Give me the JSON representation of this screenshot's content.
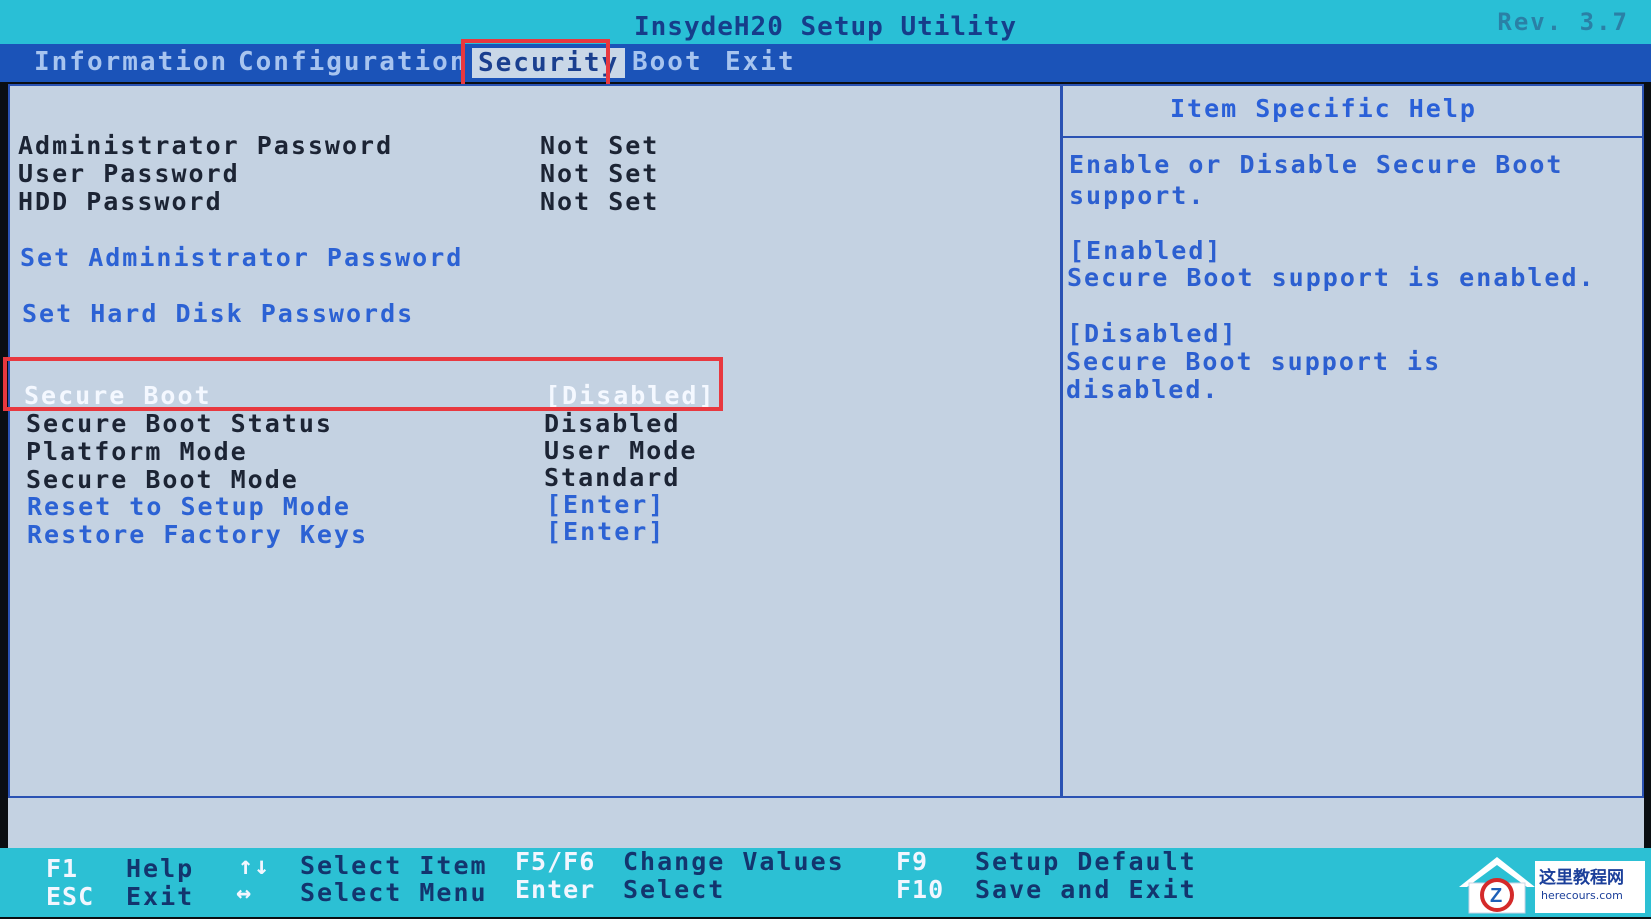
{
  "title": "InsydeH20 Setup Utility",
  "revision": "Rev. 3.7",
  "menu": [
    "Information",
    "Configuration",
    "Security",
    "Boot",
    "Exit"
  ],
  "active_menu": "Security",
  "security": {
    "passwords": [
      {
        "label": "Administrator Password",
        "value": "Not Set"
      },
      {
        "label": "User Password",
        "value": "Not Set"
      },
      {
        "label": "HDD Password",
        "value": "Not Set"
      }
    ],
    "set_admin_label": "Set Administrator Password",
    "set_hdd_label": "Set Hard Disk Passwords",
    "secure_boot": {
      "label": "Secure Boot",
      "value": "[Disabled]"
    },
    "secure_boot_status": {
      "label": "Secure Boot Status",
      "value": "Disabled"
    },
    "platform_mode": {
      "label": "Platform Mode",
      "value": "User Mode"
    },
    "secure_boot_mode": {
      "label": "Secure Boot Mode",
      "value": "Standard"
    },
    "reset_setup_mode": {
      "label": "Reset to Setup Mode",
      "value": "[Enter]"
    },
    "restore_factory_keys": {
      "label": "Restore Factory Keys",
      "value": "[Enter]"
    }
  },
  "help": {
    "title": "Item Specific Help",
    "lines": [
      "Enable or Disable Secure Boot",
      "support.",
      "[Enabled]",
      "Secure Boot support is enabled.",
      "[Disabled]",
      "Secure Boot support is",
      "disabled."
    ]
  },
  "footer": {
    "f1_key": "F1",
    "f1_desc": "Help",
    "esc_key": "ESC",
    "esc_desc": "Exit",
    "updown_key": "↑↓",
    "updown_desc": "Select Item",
    "leftright_key": "↔",
    "leftright_desc": "Select Menu",
    "f5f6_key": "F5/F6",
    "f5f6_desc": "Change Values",
    "enter_key": "Enter",
    "enter_desc": "Select",
    "f9_key": "F9",
    "f9_desc": "Setup Default",
    "f10_key": "F10",
    "f10_desc": "Save and Exit"
  },
  "watermark": {
    "site_name": "这里教程网",
    "site_url": "herecours.com"
  },
  "colors": {
    "title_bar": "#29bfd6",
    "menu_bar": "#1b53b8",
    "panel": "#c4d2e2",
    "highlight_box": "#e8383f",
    "footer": "#2cc0d4"
  }
}
